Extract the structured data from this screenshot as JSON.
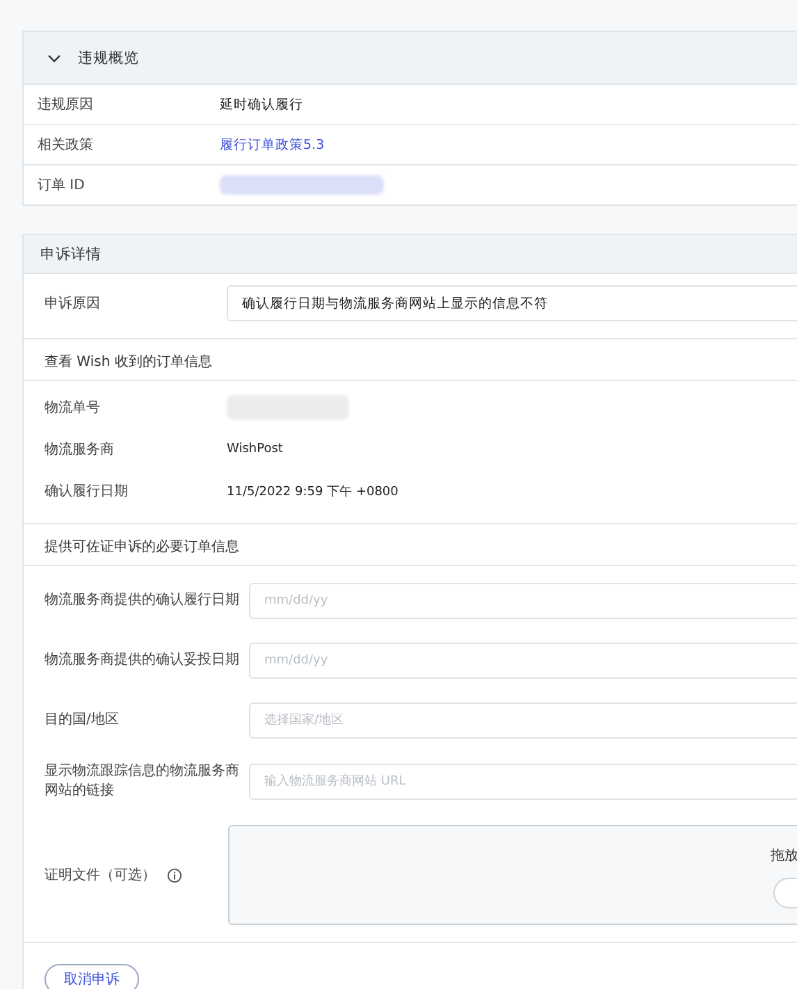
{
  "violation_overview": {
    "title": "违规概览",
    "expanded": true,
    "rows": [
      {
        "label": "违规原因",
        "value": "延时确认履行",
        "kind": "text"
      },
      {
        "label": "相关政策",
        "value": "履行订单政策5.3",
        "kind": "link"
      },
      {
        "label": "订单 ID",
        "kind": "redacted"
      }
    ]
  },
  "appeal_details": {
    "title": "申诉详情",
    "reason": {
      "label": "申诉原因",
      "value": "确认履行日期与物流服务商网站上显示的信息不符"
    },
    "wish_info": {
      "heading": "查看 Wish 收到的订单信息",
      "rows": [
        {
          "label": "物流单号",
          "kind": "redacted"
        },
        {
          "label": "物流服务商",
          "value": "WishPost",
          "kind": "text"
        },
        {
          "label": "确认履行日期",
          "value": "11/5/2022 9:59 下午 +0800",
          "kind": "text"
        }
      ]
    },
    "required_info": {
      "heading": "提供可佐证申诉的必要订单信息",
      "fields": [
        {
          "label": "物流服务商提供的确认履行日期",
          "placeholder": "mm/dd/yy"
        },
        {
          "label": "物流服务商提供的确认妥投日期",
          "placeholder": "mm/dd/yy"
        },
        {
          "label": "目的国/地区",
          "placeholder": "选择国家/地区"
        },
        {
          "label": "显示物流跟踪信息的物流服务商网站的链接",
          "placeholder": "输入物流服务商网站 URL"
        }
      ],
      "upload": {
        "label": "证明文件（可选）",
        "drop_text": "拖放"
      }
    }
  },
  "buttons": {
    "cancel": "取消申诉"
  }
}
